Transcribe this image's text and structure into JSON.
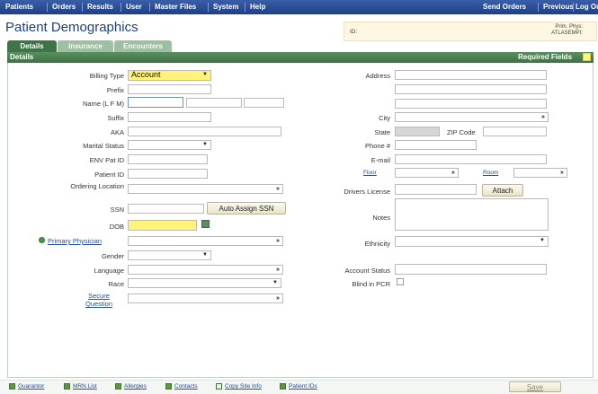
{
  "menu": {
    "left_items": [
      "Patients",
      "Orders",
      "Results",
      "User",
      "Master Files",
      "System",
      "Help"
    ],
    "right_items": [
      "Send Orders",
      "Previous",
      "Log Ou"
    ]
  },
  "header": {
    "title": "Patient Demographics",
    "id_label": "ID:",
    "prim_phys_label": "Prim. Phys:",
    "prim_phys_value": "ATLASEMPI:"
  },
  "tabs": [
    "Details",
    "Insurance",
    "Encounters"
  ],
  "section": {
    "title": "Details",
    "required_fields_label": "Required Fields",
    "required_color": "#fff37a"
  },
  "left_form": {
    "billing_type_label": "Billing Type",
    "billing_type_value": "Account",
    "prefix_label": "Prefix",
    "name_label": "Name (L F M)",
    "suffix_label": "Suffix",
    "aka_label": "AKA",
    "marital_status_label": "Marital Status",
    "env_pat_id_label": "ENV Pat ID",
    "patient_id_label": "Patient ID",
    "ordering_location_label": "Ordering Location",
    "ssn_label": "SSN",
    "auto_assign_ssn": "Auto Assign SSN",
    "dob_label": "DOB",
    "primary_physician_label": "Primary Physician",
    "gender_label": "Gender",
    "language_label": "Language",
    "race_label": "Race",
    "secure_question_label": "Secure Question"
  },
  "right_form": {
    "address_label": "Address",
    "city_label": "City",
    "state_label": "State",
    "zip_label": "ZIP Code",
    "phone_label": "Phone #",
    "email_label": "E-mail",
    "floor_label": "Floor",
    "room_label": "Room",
    "drivers_license_label": "Drivers License",
    "attach_button": "Attach",
    "notes_label": "Notes",
    "ethnicity_label": "Ethnicity",
    "account_status_label": "Account Status",
    "blind_in_pcr_label": "Blind in PCR"
  },
  "footer": {
    "links": [
      "Guarantor",
      "MRN List",
      "Allergies",
      "Contacts",
      "Copy Site Info",
      "Patient IDs"
    ],
    "save_button": "Save"
  }
}
